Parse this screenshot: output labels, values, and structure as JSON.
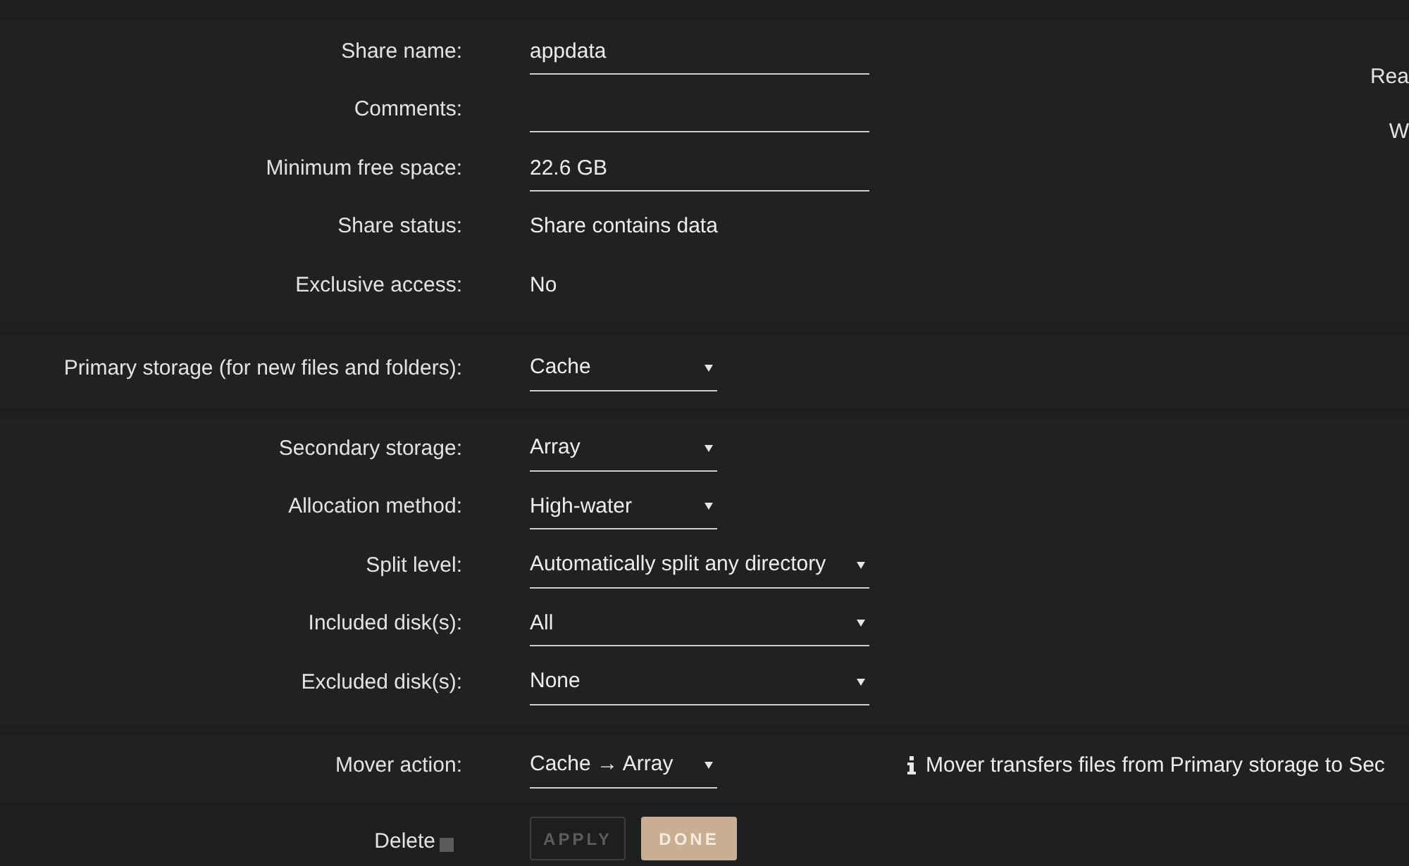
{
  "sections": [
    {
      "fields": [
        {
          "label": "Share name:",
          "kind": "input",
          "value": "appdata"
        },
        {
          "label": "Comments:",
          "kind": "input"
        },
        {
          "label": "Minimum free space:",
          "kind": "input",
          "value": "22.6 GB"
        },
        {
          "label": "Share status:",
          "kind": "text",
          "value": "Share contains data"
        },
        {
          "label": "Exclusive access:",
          "kind": "text",
          "value": "No"
        }
      ],
      "aside": [
        "Rea",
        "W"
      ]
    },
    {
      "fields": [
        {
          "label": "Primary storage (for new files and folders):",
          "kind": "select",
          "value": "Cache"
        }
      ]
    },
    {
      "fields": [
        {
          "label": "Secondary storage:",
          "kind": "select",
          "value": "Array"
        },
        {
          "label": "Allocation method:",
          "kind": "select",
          "value": "High-water"
        },
        {
          "label": "Split level:",
          "kind": "wide_select",
          "value": "Automatically split any directory"
        },
        {
          "label": "Included disk(s):",
          "kind": "wide_select",
          "value": "All"
        },
        {
          "label": "Excluded disk(s):",
          "kind": "wide_select",
          "value": "None"
        }
      ]
    },
    {
      "fields": [
        {
          "label": "Mover action:",
          "kind": "select",
          "value": "Cache → Array",
          "note": "Mover transfers files from Primary storage to Sec"
        }
      ]
    }
  ],
  "delete": {
    "label": "Delete",
    "checked": false
  },
  "buttons": [
    {
      "label": "APPLY",
      "disabled": true
    },
    {
      "label": "DONE",
      "disabled": false
    }
  ]
}
